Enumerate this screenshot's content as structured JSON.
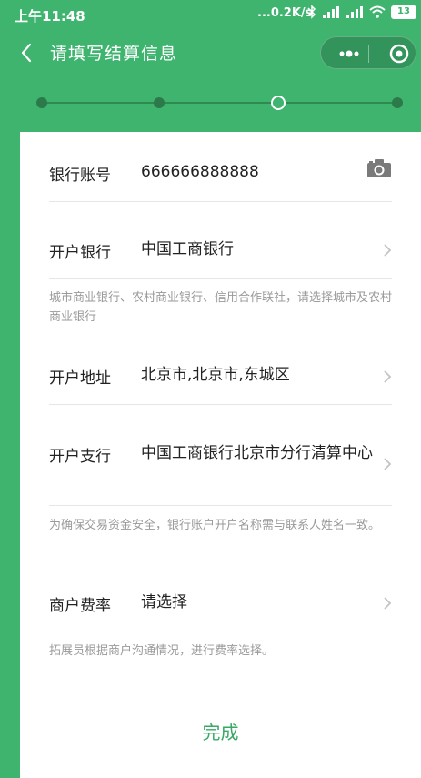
{
  "status_bar": {
    "time": "上午11:48",
    "speed": "...0.2K/s",
    "battery": "13"
  },
  "nav": {
    "title": "请填写结算信息"
  },
  "progress": {
    "steps": 4,
    "current_step": 3
  },
  "form": {
    "account": {
      "label": "银行账号",
      "value": "666666888888"
    },
    "bank": {
      "label": "开户银行",
      "value": "中国工商银行"
    },
    "bank_hint": "城市商业银行、农村商业银行、信用合作联社，请选择城市及农村商业银行",
    "address": {
      "label": "开户地址",
      "value": "北京市,北京市,东城区"
    },
    "branch": {
      "label": "开户支行",
      "value": "中国工商银行北京市分行清算中心"
    },
    "branch_hint": "为确保交易资金安全，银行账户开户名称需与联系人姓名一致。",
    "rate": {
      "label": "商户费率",
      "value": "请选择"
    },
    "rate_hint": "拓展员根据商户沟通情况，进行费率选择。"
  },
  "actions": {
    "done_label": "完成"
  },
  "colors": {
    "brand": "#3eb46f",
    "button_text": "#3aa865",
    "hint_text": "#9a9a9a"
  }
}
